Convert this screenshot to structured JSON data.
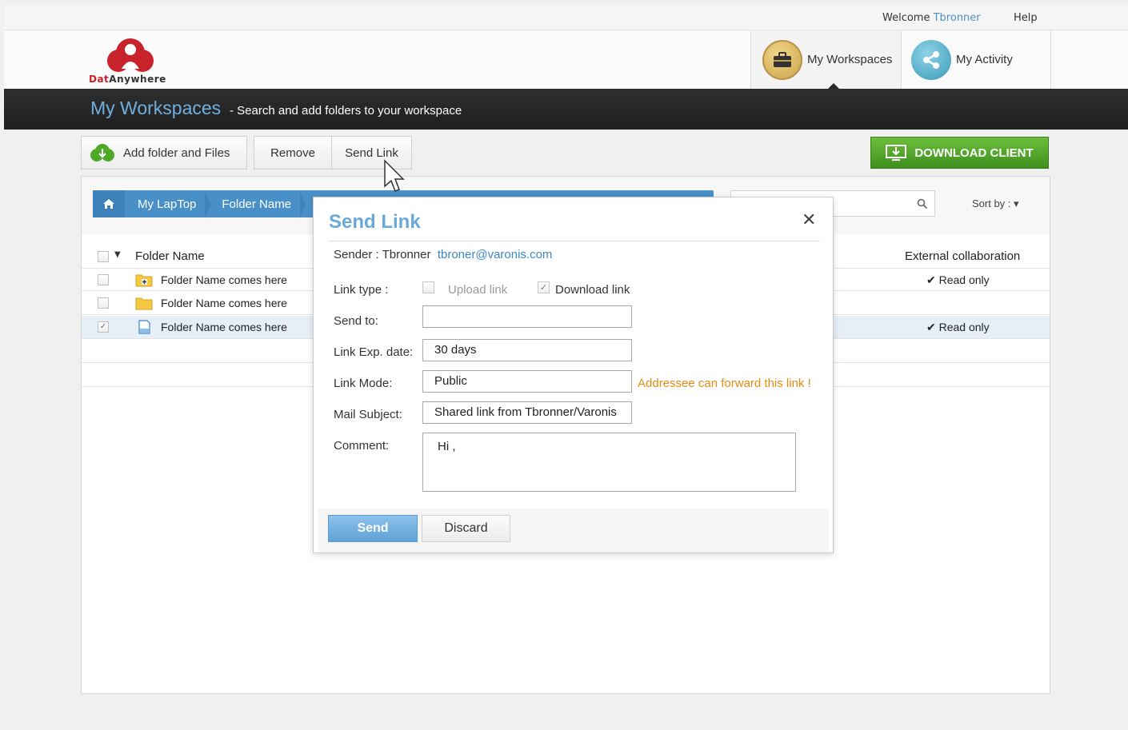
{
  "topbar": {
    "welcome_prefix": "Welcome",
    "username": "Tbronner",
    "help": "Help"
  },
  "logo": {
    "text_part1": "Dat",
    "text_part2": "Anywhere"
  },
  "nav": {
    "workspaces": "My Workspaces",
    "activity": "My Activity"
  },
  "titlebar": {
    "title": "My Workspaces",
    "subtitle": "- Search and  add folders to your  workspace"
  },
  "toolbar": {
    "add": "Add folder and Files",
    "remove": "Remove",
    "send_link": "Send Link",
    "download": "DOWNLOAD CLIENT"
  },
  "breadcrumb": [
    "My LapTop",
    "Folder Name"
  ],
  "sort_by": "Sort by :",
  "table": {
    "col_name": "Folder Name",
    "col_ext": "External collaboration",
    "rows": [
      {
        "name": "Folder Name comes here",
        "ext": "Read only",
        "checked": false,
        "icon": "folder-plus-icon"
      },
      {
        "name": "Folder Name comes here",
        "ext": "",
        "checked": false,
        "icon": "folder-icon"
      },
      {
        "name": "Folder Name comes here",
        "ext": "Read only",
        "checked": true,
        "icon": "document-icon"
      }
    ]
  },
  "modal": {
    "title": "Send Link",
    "sender_label": "Sender : Tbronner",
    "sender_email": "tbroner@varonis.com",
    "link_type_label": "Link type :",
    "upload_link": "Upload link",
    "download_link": "Download link",
    "send_to_label": "Send to:",
    "send_to_value": "",
    "exp_label": "Link Exp. date:",
    "exp_value": "30 days",
    "mode_label": "Link Mode:",
    "mode_value": "Public",
    "mode_note": "Addressee can forward this link !",
    "subject_label": "Mail Subject:",
    "subject_value": "Shared link from Tbronner/Varonis",
    "comment_label": "Comment:",
    "comment_value": "Hi ,",
    "send": "Send",
    "discard": "Discard"
  },
  "colors": {
    "accent": "#4a90c8",
    "download_green": "#4f9f27",
    "note_orange": "#e38b13",
    "logo_red": "#c8232c"
  }
}
